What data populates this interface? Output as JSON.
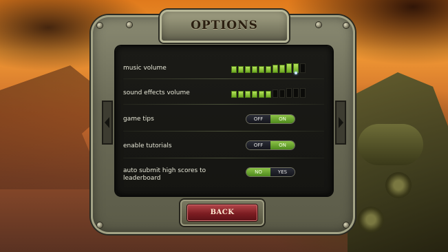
{
  "title": "OPTIONS",
  "settings": {
    "music_volume": {
      "label": "music volume",
      "level": 10,
      "segments": 11
    },
    "sound_effects_volume": {
      "label": "sound effects volume",
      "level": 6,
      "segments": 11
    },
    "game_tips": {
      "label": "game tips",
      "options": [
        "OFF",
        "ON"
      ],
      "selected": "ON"
    },
    "enable_tutorials": {
      "label": "enable tutorials",
      "options": [
        "OFF",
        "ON"
      ],
      "selected": "ON"
    },
    "auto_submit": {
      "label": "auto submit high scores to leaderboard",
      "options": [
        "NO",
        "YES"
      ],
      "selected": "NO"
    }
  },
  "back_label": "BACK",
  "colors": {
    "active_green": "#7cb63a",
    "back_red": "#8b262b",
    "frame": "#6c6c58"
  }
}
